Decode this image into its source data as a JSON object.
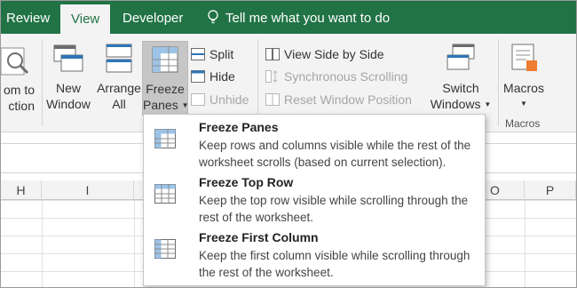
{
  "tabs": {
    "review": "Review",
    "view": "View",
    "developer": "Developer",
    "tell_me": "Tell me what you want to do"
  },
  "ribbon": {
    "zoom_line1": "om to",
    "zoom_line2": "ction",
    "new_window_line1": "New",
    "new_window_line2": "Window",
    "arrange_all_line1": "Arrange",
    "arrange_all_line2": "All",
    "freeze_line1": "Freeze",
    "freeze_line2": "Panes",
    "split": "Split",
    "hide": "Hide",
    "unhide": "Unhide",
    "view_side_by_side": "View Side by Side",
    "synchronous_scrolling": "Synchronous Scrolling",
    "reset_window_position": "Reset Window Position",
    "switch_windows_line1": "Switch",
    "switch_windows_line2": "Windows",
    "macros_label": "Macros",
    "macros_group": "Macros"
  },
  "columns": [
    "H",
    "I",
    "O",
    "P"
  ],
  "menu": {
    "items": [
      {
        "title": "Freeze Panes",
        "desc": "Keep rows and columns visible while the rest of the worksheet scrolls (based on current selection)."
      },
      {
        "title": "Freeze Top Row",
        "desc": "Keep the top row visible while scrolling through the rest of the worksheet."
      },
      {
        "title": "Freeze First Column",
        "desc": "Keep the first column visible while scrolling through the rest of the worksheet."
      }
    ]
  },
  "colors": {
    "accent": "#217346",
    "ribbon_bg": "#f3f3f3",
    "freeze_pressed": "#c6c6c6",
    "icon_blue": "#2e75b6"
  }
}
